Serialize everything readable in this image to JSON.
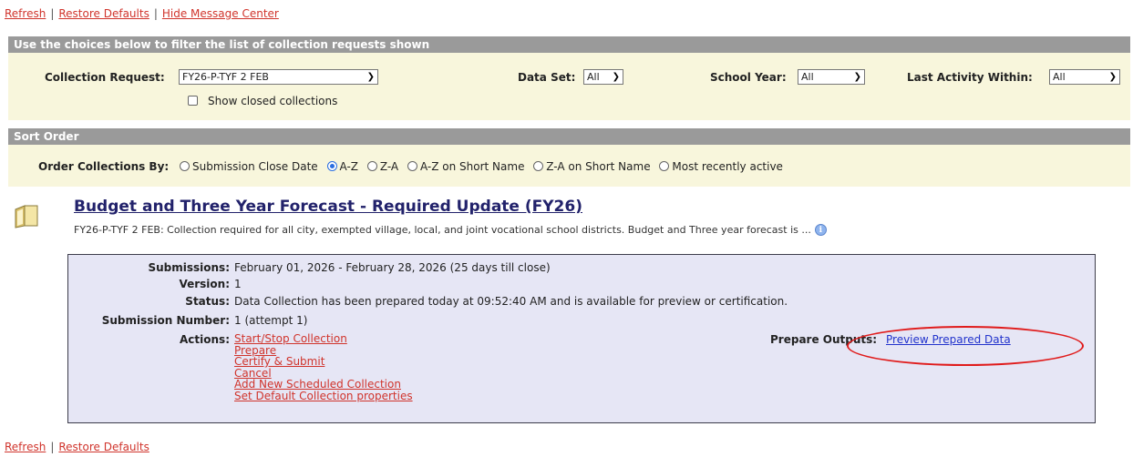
{
  "top_links": [
    "Refresh",
    "Restore Defaults",
    "Hide Message Center"
  ],
  "filter": {
    "header": "Use the choices below to filter the list of collection requests shown",
    "collection_request_label": "Collection Request:",
    "collection_request_value": "FY26-P-TYF 2 FEB",
    "show_closed_label": "Show closed collections",
    "data_set_label": "Data Set:",
    "data_set_value": "All",
    "school_year_label": "School Year:",
    "school_year_value": "All",
    "last_activity_label": "Last Activity Within:",
    "last_activity_value": "All"
  },
  "sort": {
    "header": "Sort Order",
    "label": "Order Collections By:",
    "options": [
      "Submission Close Date",
      "A-Z",
      "Z-A",
      "A-Z on Short Name",
      "Z-A on Short Name",
      "Most recently active"
    ],
    "selected": "A-Z"
  },
  "collection": {
    "icon": "folder-icon",
    "title": "Budget and Three Year Forecast - Required Update (FY26)",
    "description": "FY26-P-TYF 2 FEB: Collection required for all city, exempted village, local, and joint vocational school districts. Budget and Three year forecast is ...",
    "details": {
      "submissions_label": "Submissions:",
      "submissions_value": "February 01, 2026 - February 28, 2026 (25 days till close)",
      "version_label": "Version:",
      "version_value": "1",
      "status_label": "Status:",
      "status_value": "Data Collection has been prepared today at 09:52:40 AM and is available for preview or certification.",
      "submission_number_label": "Submission Number:",
      "submission_number_value": "1 (attempt 1)",
      "actions_label": "Actions:",
      "actions": [
        "Start/Stop Collection",
        "Prepare",
        "Certify & Submit",
        "Cancel",
        "Add New Scheduled Collection",
        "Set Default Collection properties"
      ],
      "prepare_outputs_label": "Prepare Outputs:",
      "prepare_outputs_link": "Preview Prepared Data"
    }
  },
  "bottom_links": [
    "Refresh",
    "Restore Defaults"
  ],
  "colors": {
    "link": "#d0342c",
    "blue_link": "#2233cc",
    "header_bar": "#9a9a9a",
    "panel_bg": "#f8f6dc",
    "details_bg": "#e6e6f5",
    "highlight_oval": "#e01b1b"
  }
}
